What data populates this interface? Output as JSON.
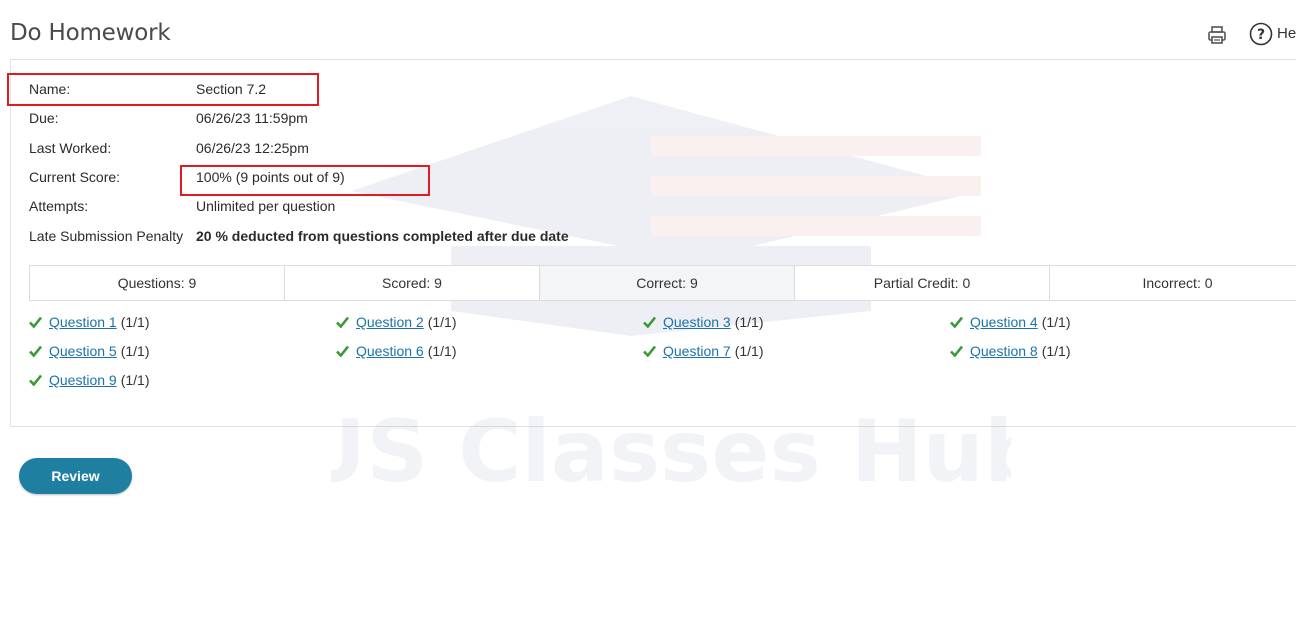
{
  "header": {
    "title": "Do Homework",
    "help_label": "He",
    "icons": [
      "print-icon",
      "help-icon"
    ]
  },
  "assignment": {
    "name_label": "Name:",
    "name_value": "Section 7.2",
    "due_label": "Due:",
    "due_value": "06/26/23 11:59pm",
    "last_worked_label": "Last Worked:",
    "last_worked_value": "06/26/23 12:25pm",
    "score_label": "Current Score:",
    "score_value": "100% (9 points out of 9)",
    "attempts_label": "Attempts:",
    "attempts_value": "Unlimited per question",
    "penalty_label": "Late Submission Penalty",
    "penalty_value": "20 % deducted from questions completed after due date"
  },
  "stats": [
    {
      "label": "Questions: 9"
    },
    {
      "label": "Scored: 9"
    },
    {
      "label": "Correct: 9"
    },
    {
      "label": "Partial Credit: 0"
    },
    {
      "label": "Incorrect: 0"
    }
  ],
  "questions": [
    {
      "link": "Question 1",
      "score": "(1/1)",
      "status_icon": "check-icon"
    },
    {
      "link": "Question 2",
      "score": "(1/1)",
      "status_icon": "check-icon"
    },
    {
      "link": "Question 3",
      "score": "(1/1)",
      "status_icon": "check-icon"
    },
    {
      "link": "Question 4",
      "score": "(1/1)",
      "status_icon": "check-icon"
    },
    {
      "link": "Question 5",
      "score": "(1/1)",
      "status_icon": "check-icon"
    },
    {
      "link": "Question 6",
      "score": "(1/1)",
      "status_icon": "check-icon"
    },
    {
      "link": "Question 7",
      "score": "(1/1)",
      "status_icon": "check-icon"
    },
    {
      "link": "Question 8",
      "score": "(1/1)",
      "status_icon": "check-icon"
    },
    {
      "link": "Question 9",
      "score": "(1/1)",
      "status_icon": "check-icon"
    }
  ],
  "actions": {
    "review_label": "Review"
  },
  "watermark": {
    "text": "US Classes Hub"
  },
  "colors": {
    "link": "#1b73a8",
    "check": "#3a9a3a",
    "highlight": "#e01b24",
    "button": "#1e7fa1"
  }
}
